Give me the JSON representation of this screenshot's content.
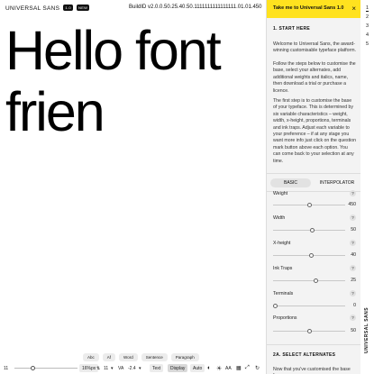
{
  "header": {
    "brand": "UNIVERSAL SANS",
    "badge1": "1.0",
    "badge2": "NEW",
    "build": "BuildID v2.0.0.50.25.40.50.1111111111111111.01.01.450"
  },
  "specimen": {
    "text": "Hello font frien"
  },
  "toolbar": {
    "chips": [
      "Abc",
      "Af",
      "Word",
      "Sentence",
      "Paragraph"
    ],
    "size_label": "11",
    "px_value": "16%px",
    "line_value": "11",
    "tracking_label": "VA",
    "tracking_value": "-2.4",
    "mode_text": "Text",
    "mode_display": "Display",
    "auto_label": "Auto",
    "aa_label": "AA"
  },
  "panel": {
    "cta": "Take me to Universal Sans 1.0",
    "close": "×",
    "section1_title": "1. START HERE",
    "para1": "Welcome to Universal Sans, the award-winning customisable typeface platform.",
    "para2": "Follow the steps below to customise the base, select your alternates, add additional weights and italics, name, then download a trial or purchase a licence.",
    "para3": "The first step is to customise the base of your typeface. This is determined by six variable characteristics – weight, width, x-height, proportions, terminals and ink traps. Adjust each variable to your preference – if at any stage you want more info just click on the question mark button above each option. You can come back to your selection at any time.",
    "tabs": {
      "basic": "BASIC",
      "interpolator": "INTERPOLATOR"
    },
    "help": "?",
    "controls": [
      {
        "label": "Weight",
        "value": "450",
        "level": 0.5
      },
      {
        "label": "Width",
        "value": "50",
        "level": 0.55
      },
      {
        "label": "X-height",
        "value": "40",
        "level": 0.53
      },
      {
        "label": "Ink Traps",
        "value": "25",
        "level": 0.6
      },
      {
        "label": "Terminals",
        "value": "0",
        "level": 0.0
      },
      {
        "label": "Proportions",
        "value": "50",
        "level": 0.5
      }
    ],
    "section2_title": "2A. SELECT ALTERNATES",
    "para4": "Now that you've customised the base for"
  },
  "steps": [
    "1",
    "2",
    "3",
    "4",
    "5"
  ],
  "side_label": "UNIVERSAL SANS"
}
